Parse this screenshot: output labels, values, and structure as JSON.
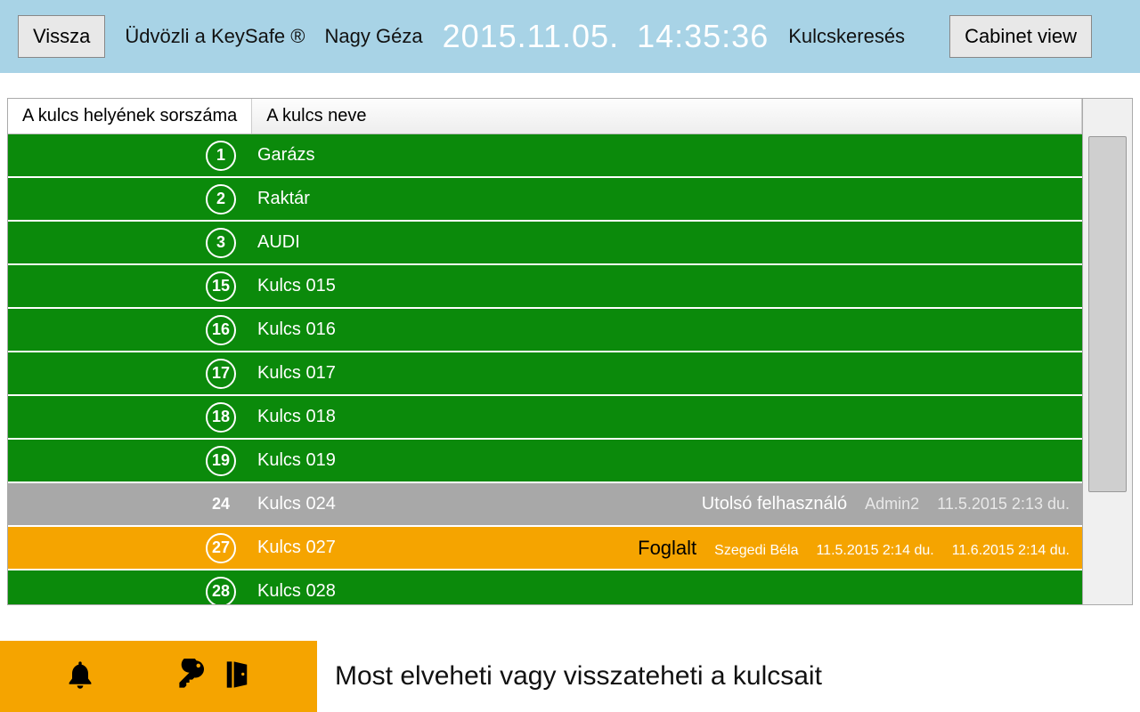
{
  "header": {
    "back_label": "Vissza",
    "welcome": "Üdvözli a KeySafe ®",
    "user": "Nagy Géza",
    "date": "2015.11.05.",
    "time": "14:35:36",
    "search_label": "Kulcskeresés",
    "cabinet_label": "Cabinet view"
  },
  "columns": {
    "slot": "A kulcs helyének sorszáma",
    "name": "A kulcs neve"
  },
  "rows": [
    {
      "state": "green",
      "num": "1",
      "name": "Garázs"
    },
    {
      "state": "green",
      "num": "2",
      "name": "Raktár"
    },
    {
      "state": "green",
      "num": "3",
      "name": "AUDI"
    },
    {
      "state": "green",
      "num": "15",
      "name": "Kulcs 015"
    },
    {
      "state": "green",
      "num": "16",
      "name": "Kulcs 016"
    },
    {
      "state": "green",
      "num": "17",
      "name": "Kulcs 017"
    },
    {
      "state": "green",
      "num": "18",
      "name": "Kulcs 018"
    },
    {
      "state": "green",
      "num": "19",
      "name": "Kulcs 019"
    },
    {
      "state": "gray",
      "num": "24",
      "name": "Kulcs 024",
      "meta": {
        "label": "Utolsó felhasználó",
        "user": "Admin2",
        "d1": "11.5.2015 2:13 du."
      }
    },
    {
      "state": "orange",
      "num": "27",
      "name": "Kulcs 027",
      "meta": {
        "label": "Foglalt",
        "user": "Szegedi Béla",
        "d1": "11.5.2015 2:14 du.",
        "d2": "11.6.2015 2:14 du."
      }
    },
    {
      "state": "green",
      "num": "28",
      "name": "Kulcs 028"
    }
  ],
  "footer": {
    "message": "Most elveheti vagy visszateheti a kulcsait"
  }
}
